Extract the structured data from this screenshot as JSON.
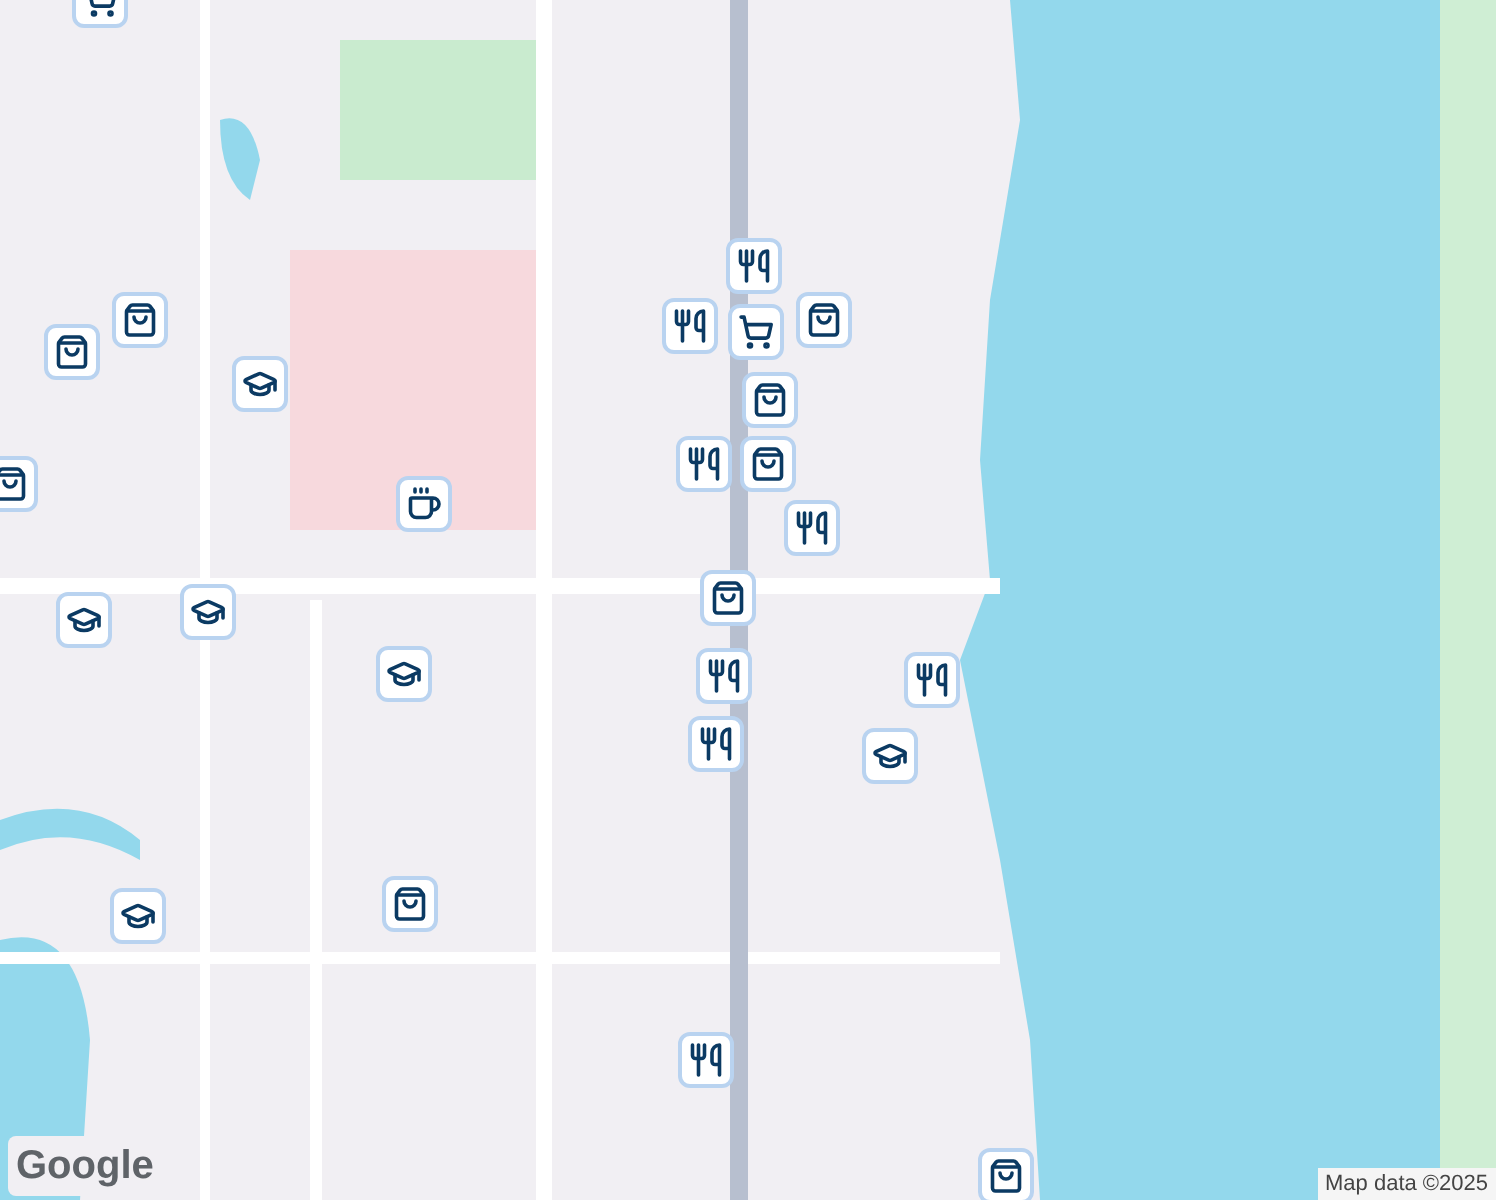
{
  "map": {
    "pins": [
      {
        "kind": "cart"
      },
      {
        "kind": "bag"
      },
      {
        "kind": "bag"
      },
      {
        "kind": "cap"
      },
      {
        "kind": "bag"
      },
      {
        "kind": "coffee"
      },
      {
        "kind": "cap"
      },
      {
        "kind": "cap"
      },
      {
        "kind": "cap"
      },
      {
        "kind": "fork"
      },
      {
        "kind": "fork"
      },
      {
        "kind": "bag"
      },
      {
        "kind": "cart"
      },
      {
        "kind": "bag"
      },
      {
        "kind": "fork"
      },
      {
        "kind": "bag"
      },
      {
        "kind": "fork"
      },
      {
        "kind": "bag"
      },
      {
        "kind": "fork"
      },
      {
        "kind": "fork"
      },
      {
        "kind": "fork"
      },
      {
        "kind": "cap"
      },
      {
        "kind": "bag"
      },
      {
        "kind": "cap"
      },
      {
        "kind": "fork"
      },
      {
        "kind": "bag"
      }
    ],
    "logo": "Google",
    "attribution": "Map data ©2025"
  }
}
